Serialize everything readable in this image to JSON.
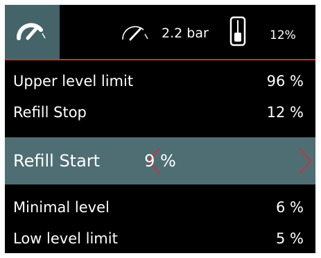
{
  "colors": {
    "background": "#000000",
    "tab_active": "#45646a",
    "selected_row": "#4e6e73",
    "accent_red": "#c8343b",
    "text": "#ffffff"
  },
  "topbar": {
    "tab_icon": "gauge-icon",
    "pressure_icon": "gauge-icon",
    "pressure": "2.2 bar",
    "tank_icon": "tank-level-icon",
    "level": "12%"
  },
  "settings": {
    "upper_level_limit": {
      "label": "Upper level limit",
      "value": "96 %"
    },
    "refill_stop": {
      "label": "Refill Stop",
      "value": "12 %"
    },
    "refill_start": {
      "label": "Refill Start",
      "value": "9 %",
      "prev_icon": "chevron-left-icon",
      "next_icon": "chevron-right-icon"
    },
    "minimal_level": {
      "label": "Minimal level",
      "value": "6 %"
    },
    "low_level_limit": {
      "label": "Low level limit",
      "value": "5 %"
    }
  }
}
